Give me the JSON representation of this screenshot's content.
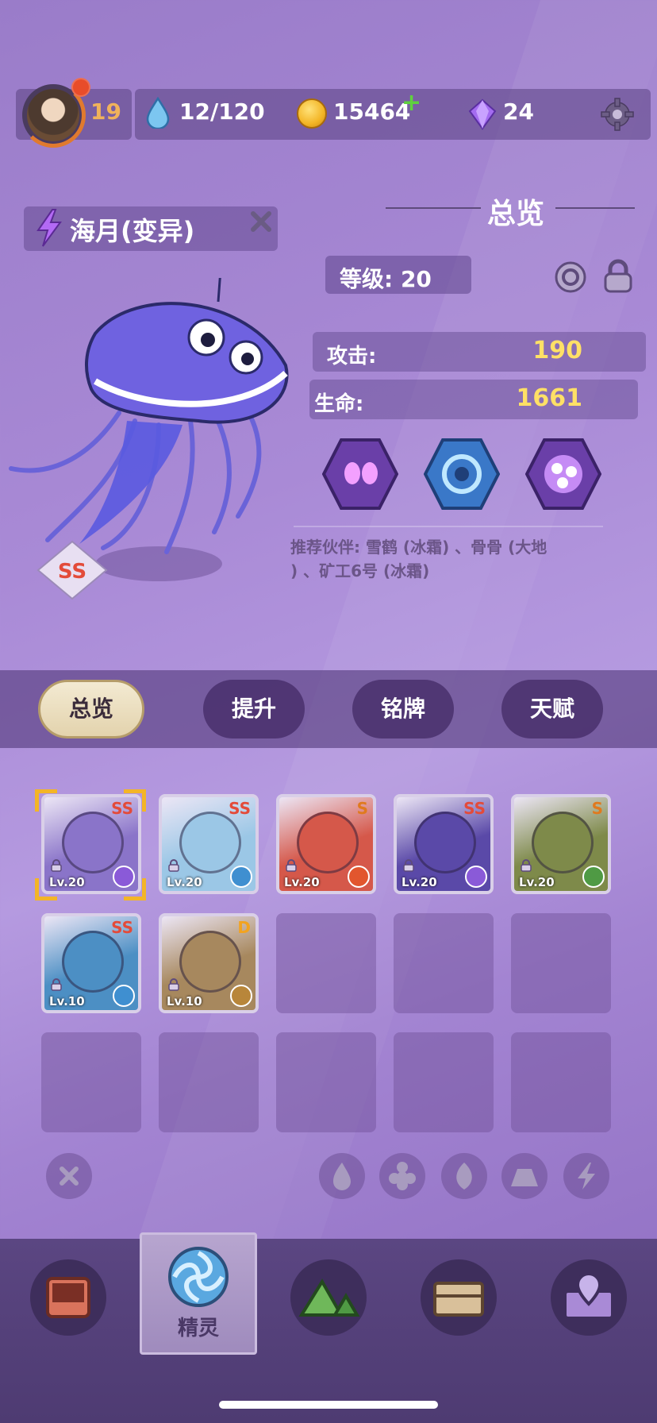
{
  "resources": {
    "player_level": "19",
    "energy": "12/120",
    "coins": "15464",
    "gems": "24"
  },
  "creature": {
    "name": "海月(变异)",
    "rarity": "SS",
    "level_label": "等级: 20",
    "overview_title": "总览",
    "stats": [
      {
        "label": "攻击:",
        "value": "190"
      },
      {
        "label": "生命:",
        "value": "1661"
      }
    ],
    "recommend_line1": "推荐伙伴: 雪鹤 (冰霜) 、骨骨 (大地",
    "recommend_line2": ") 、矿工6号 (冰霜)"
  },
  "tabs": [
    {
      "label": "总览",
      "active": true
    },
    {
      "label": "提升",
      "active": false
    },
    {
      "label": "铭牌",
      "active": false
    },
    {
      "label": "天赋",
      "active": false
    }
  ],
  "roster": [
    {
      "rarity": "SS",
      "level": "Lv.20",
      "element": "lightning",
      "color": "#8a74c9"
    },
    {
      "rarity": "SS",
      "level": "Lv.20",
      "element": "frost",
      "color": "#9bc7e6"
    },
    {
      "rarity": "S",
      "level": "Lv.20",
      "element": "fire",
      "color": "#d5584a"
    },
    {
      "rarity": "SS",
      "level": "Lv.20",
      "element": "lightning",
      "color": "#5a49a8"
    },
    {
      "rarity": "S",
      "level": "Lv.20",
      "element": "nature",
      "color": "#7e8a4a"
    },
    {
      "rarity": "SS",
      "level": "Lv.10",
      "element": "frost",
      "color": "#4c8fc4"
    },
    {
      "rarity": "D",
      "level": "Lv.10",
      "element": "earth",
      "color": "#a7885e"
    }
  ],
  "nav": {
    "active_label": "精灵"
  },
  "colors": {
    "gold": "#ffe066",
    "rarity_ss": "#e34b3a",
    "rarity_s": "#e07a1e",
    "rarity_d": "#f2a320"
  }
}
